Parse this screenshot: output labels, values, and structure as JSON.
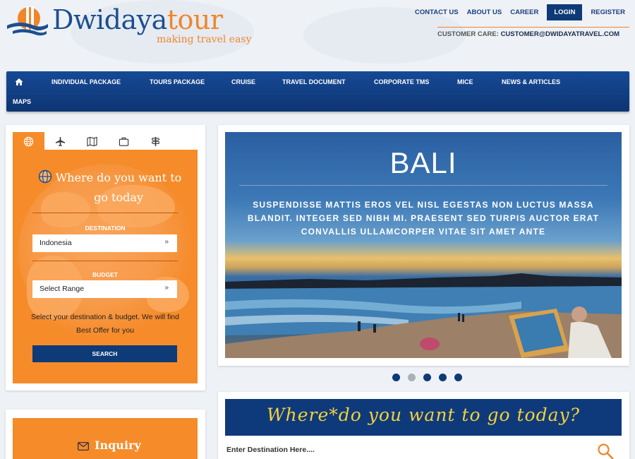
{
  "header": {
    "brand_main": "Dwidaya",
    "brand_accent": "tour",
    "tagline": "making travel easy",
    "links": {
      "contact": "CONTACT US",
      "about": "ABOUT US",
      "career": "CAREER",
      "login": "LOGIN",
      "register": "REGISTER"
    },
    "customer_care_label": "CUSTOMER CARE:",
    "customer_care_email": "CUSTOMER@DWIDAYATRAVEL.COM"
  },
  "nav": {
    "home_icon": "home-icon",
    "items": [
      "INDIVIDUAL PACKAGE",
      "TOURS PACKAGE",
      "CRUISE",
      "TRAVEL DOCUMENT",
      "CORPORATE TMS",
      "MICE",
      "NEWS & ARTICLES",
      "MAPS"
    ]
  },
  "search_panel": {
    "tabs": [
      "globe-icon",
      "plane-icon",
      "map-icon",
      "briefcase-icon",
      "signpost-icon"
    ],
    "title": "Where do you want to go today",
    "destination_label": "DESTINATION",
    "destination_value": "Indonesia",
    "budget_label": "BUDGET",
    "budget_value": "Select Range",
    "help_text": "Select your destination & budget. We will find Best Offer for you",
    "search_button": "SEARCH"
  },
  "inquiry": {
    "label": "Inquiry"
  },
  "slider": {
    "title": "BALI",
    "text": "SUSPENDISSE MATTIS EROS VEL NISL EGESTAS NON LUCTUS MASSA BLANDIT. INTEGER SED NIBH MI. PRAESENT SED TURPIS AUCTOR ERAT CONVALLIS ULLAMCORPER VITAE SIT AMET ANTE",
    "active_slide": 1,
    "slide_count": 5
  },
  "destination_search": {
    "banner": "Where*do you want to go today?",
    "placeholder": "Enter Destination Here...."
  },
  "colors": {
    "brand_blue": "#0f3a78",
    "brand_orange": "#f68b2a",
    "banner_yellow": "#f5d03a"
  }
}
